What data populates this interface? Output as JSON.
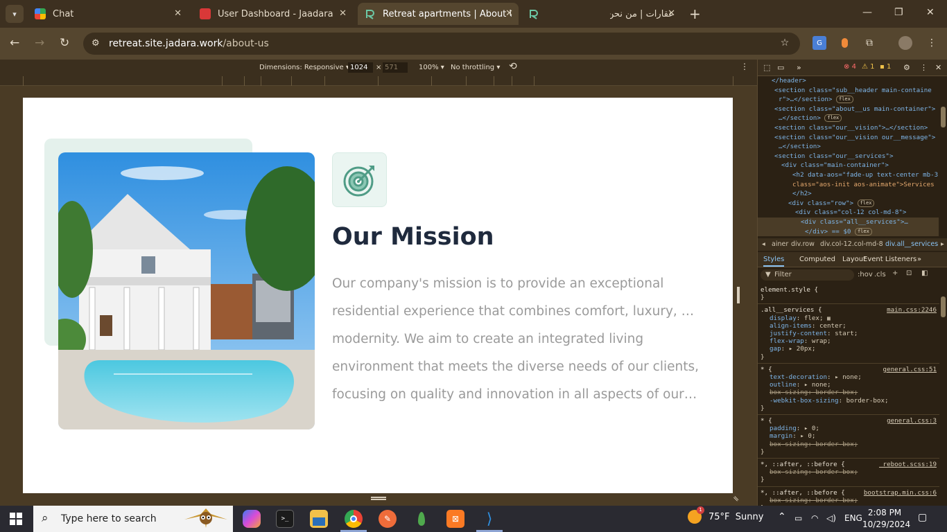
{
  "tabs": [
    {
      "label": "Chat",
      "close": "✕"
    },
    {
      "label": "User Dashboard - Jaadara",
      "close": "✕"
    },
    {
      "label": "Retreat apartments | About Us",
      "close": "✕"
    },
    {
      "label": "عقارات | من نحن",
      "close": "✕"
    }
  ],
  "new_tab": "+",
  "window_controls": {
    "minimize": "—",
    "restore": "❐",
    "close": "✕"
  },
  "address": {
    "host": "retreat.site.jadara.work",
    "path": "/about-us"
  },
  "device_toolbar": {
    "dimensions_label": "Dimensions: Responsive",
    "width": "1024",
    "x": "×",
    "height": "571",
    "zoom": "100%",
    "throttling": "No throttling"
  },
  "page": {
    "mission_title": "Our Mission",
    "mission_lines": [
      "Our company's mission is to provide an exceptional",
      "residential experience that combines comfort, luxury, and",
      "modernity. We aim to create an integrated living",
      "environment that meets the diverse needs of our clients,",
      "focusing on quality and innovation in all aspects of our re..."
    ],
    "accent_color": "#4f9c86"
  },
  "devtools": {
    "errors": "4",
    "warnings": "1",
    "info": "1",
    "dom_lines": [
      {
        "indent": 0,
        "html": "</header>"
      },
      {
        "indent": 0,
        "html": "<section class=\"sub__header main-containe"
      },
      {
        "indent": 0,
        "html": "r\">…</section>"
      },
      {
        "indent": 0,
        "html": "<section class=\"about__us main-container\">"
      },
      {
        "indent": 0,
        "html": "…</section>"
      },
      {
        "indent": 0,
        "html": "<section class=\"our__vision\">…</section>"
      },
      {
        "indent": 0,
        "html": "<section class=\"our__vision our__message\">"
      },
      {
        "indent": 0,
        "html": "…</section>"
      },
      {
        "indent": 0,
        "html": "<section class=\"our__services\">"
      },
      {
        "indent": 1,
        "html": "<div class=\"main-container\">"
      },
      {
        "indent": 2,
        "html": "<h2 data-aos=\"fade-up text-center mb-3\""
      },
      {
        "indent": 2,
        "html": "class=\"aos-init aos-animate\">Services"
      },
      {
        "indent": 2,
        "html": "</h2>"
      },
      {
        "indent": 2,
        "html": "<div class=\"row\">"
      },
      {
        "indent": 3,
        "html": "<div class=\"col-12 col-md-8\">"
      },
      {
        "indent": 4,
        "html": "<div class=\"all__services\">…"
      },
      {
        "indent": 4,
        "html": "</div> == $0"
      }
    ],
    "breadcrumbs": [
      "ainer",
      "div.row",
      "div.col-12.col-md-8",
      "div.all__services"
    ],
    "subtabs": [
      "Styles",
      "Computed",
      "Layout",
      "Event Listeners"
    ],
    "filter_placeholder": "Filter",
    "filter_tools": [
      ":hov",
      ".cls"
    ],
    "rules": [
      {
        "selector": "element.style {",
        "source": "",
        "props": [],
        "close": "}"
      },
      {
        "selector": ".all__services {",
        "source": "main.css:2246",
        "props": [
          {
            "name": "display",
            "value": "flex;",
            "strike": false
          },
          {
            "name": "align-items",
            "value": "center;",
            "strike": false
          },
          {
            "name": "justify-content",
            "value": "start;",
            "strike": false
          },
          {
            "name": "flex-wrap",
            "value": "wrap;",
            "strike": false
          },
          {
            "name": "gap",
            "value": "▸ 20px;",
            "strike": false
          }
        ],
        "close": "}"
      },
      {
        "selector": "* {",
        "source": "general.css:51",
        "props": [
          {
            "name": "text-decoration",
            "value": "▸ none;",
            "strike": false
          },
          {
            "name": "outline",
            "value": "▸ none;",
            "strike": false
          },
          {
            "name": "box-sizing",
            "value": "border-box;",
            "strike": true
          },
          {
            "name": "-webkit-box-sizing",
            "value": "border-box;",
            "strike": false
          }
        ],
        "close": "}"
      },
      {
        "selector": "* {",
        "source": "general.css:3",
        "props": [
          {
            "name": "padding",
            "value": "▸ 0;",
            "strike": false
          },
          {
            "name": "margin",
            "value": "▸ 0;",
            "strike": false
          },
          {
            "name": "box-sizing",
            "value": "border-box;",
            "strike": true
          }
        ],
        "close": "}"
      },
      {
        "selector": "*, ::after, ::before {",
        "source": "_reboot.scss:19",
        "props": [
          {
            "name": "box-sizing",
            "value": "border-box;",
            "strike": true
          }
        ],
        "close": "}"
      },
      {
        "selector": "*, ::after, ::before {",
        "source": "bootstrap.min.css:6",
        "props": [
          {
            "name": "box-sizing",
            "value": "border-box;",
            "strike": true
          }
        ],
        "close": "}"
      }
    ]
  },
  "taskbar": {
    "search_placeholder": "Type here to search",
    "weather": "75°F  Sunny",
    "weather_badge": "1",
    "language": "ENG",
    "time": "2:08 PM",
    "date": "10/29/2024"
  }
}
